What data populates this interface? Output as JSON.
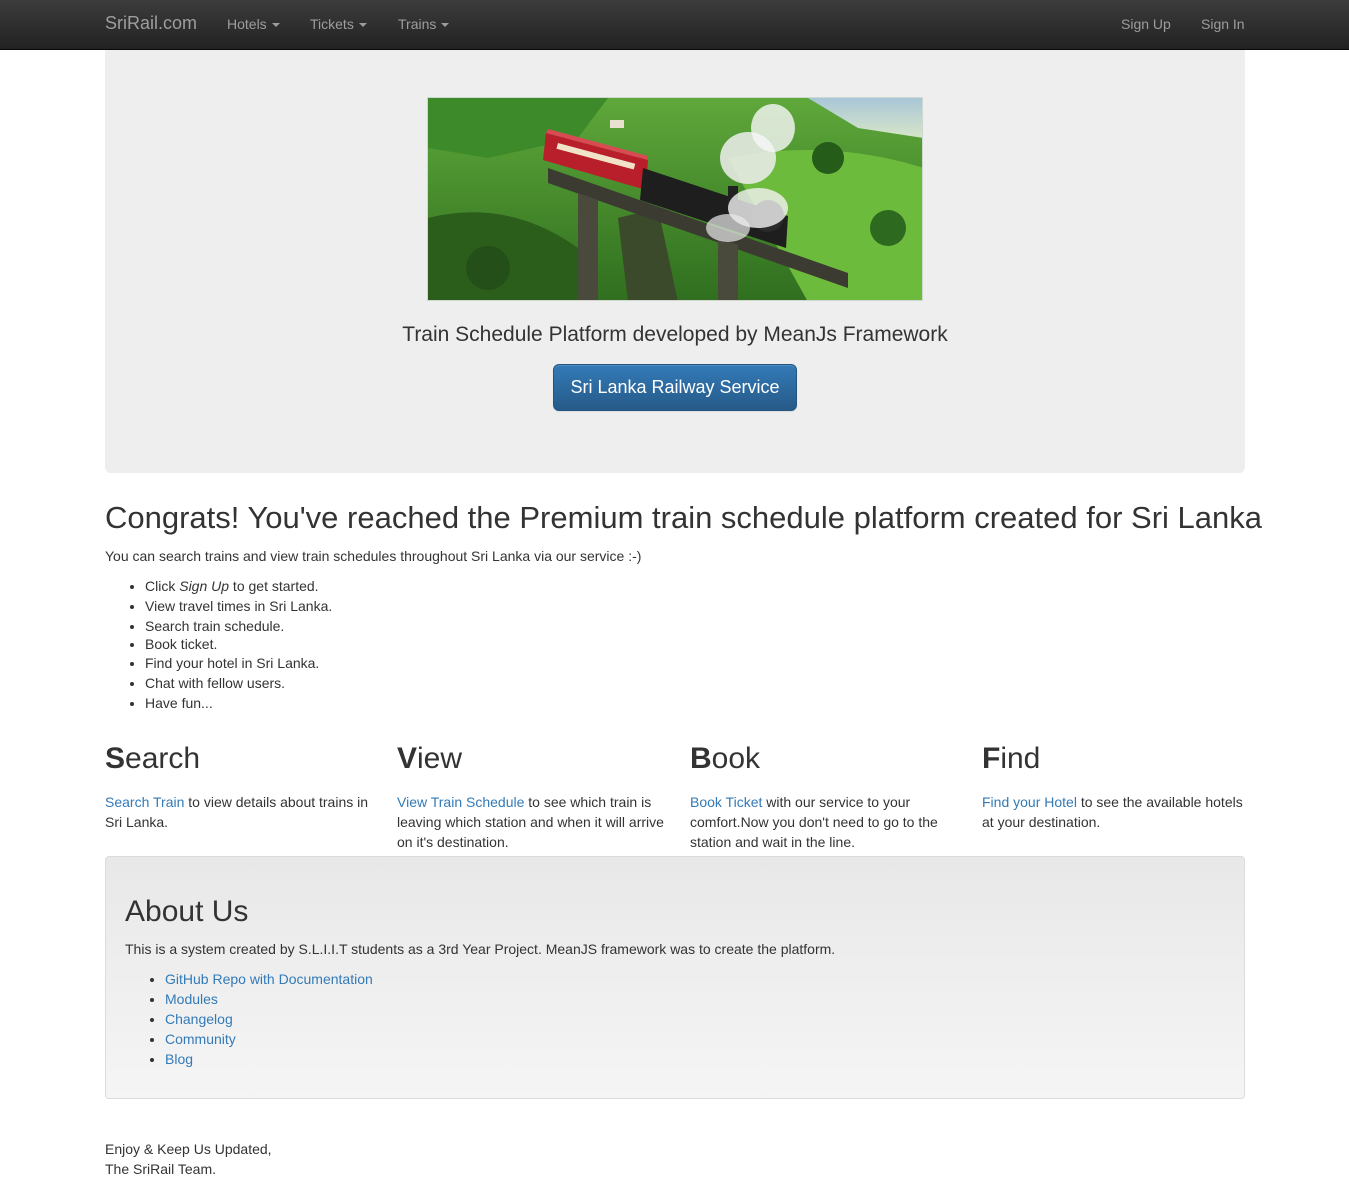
{
  "navbar": {
    "brand": "SriRail.com",
    "menus": [
      {
        "label": "Hotels"
      },
      {
        "label": "Tickets"
      },
      {
        "label": "Trains"
      }
    ],
    "sign_up": "Sign Up",
    "sign_in": "Sign In"
  },
  "jumbotron": {
    "image_description": "steam train on bridge through tea plantation",
    "tagline": "Train Schedule Platform developed by MeanJs Framework",
    "button_label": "Sri Lanka Railway Service"
  },
  "intro": {
    "heading": "Congrats! You've reached the Premium train schedule platform created for Sri Lanka",
    "lead": "You can search trains and view train schedules throughout Sri Lanka via our service :-)",
    "list": {
      "item1_prefix": "Click ",
      "item1_em": "Sign Up",
      "item1_suffix": " to get started.",
      "item2": "View travel times in Sri Lanka.",
      "item3": "Search train schedule.",
      "item4": "Book ticket.",
      "item5": "Find your hotel in Sri Lanka.",
      "item6": "Chat with fellow users.",
      "item7": "Have fun..."
    }
  },
  "columns": [
    {
      "initial": "S",
      "rest": "earch",
      "link": "Search Train",
      "text": " to view details about trains in Sri Lanka."
    },
    {
      "initial": "V",
      "rest": "iew",
      "link": "View Train Schedule",
      "text": " to see which train is leaving which station and when it will arrive on it's destination."
    },
    {
      "initial": "B",
      "rest": "ook",
      "link": "Book Ticket",
      "text": " with our service to your comfort.Now you don't need to go to the station and wait in the line."
    },
    {
      "initial": "F",
      "rest": "ind",
      "link": "Find your Hotel",
      "text": " to see the available hotels at your destination."
    }
  ],
  "about": {
    "heading": "About Us",
    "text": "This is a system created by S.L.I.I.T students as a 3rd Year Project. MeanJS framework was to create the platform.",
    "links": [
      "GitHub Repo with Documentation",
      "Modules",
      "Changelog",
      "Community",
      "Blog"
    ]
  },
  "signoff": {
    "line1": "Enjoy & Keep Us Updated,",
    "line2": "The SriRail Team."
  },
  "colors": {
    "navbar": "#222222",
    "link": "#337ab7",
    "primary_button": "#337ab7",
    "jumbotron_bg": "#eeeeee"
  }
}
